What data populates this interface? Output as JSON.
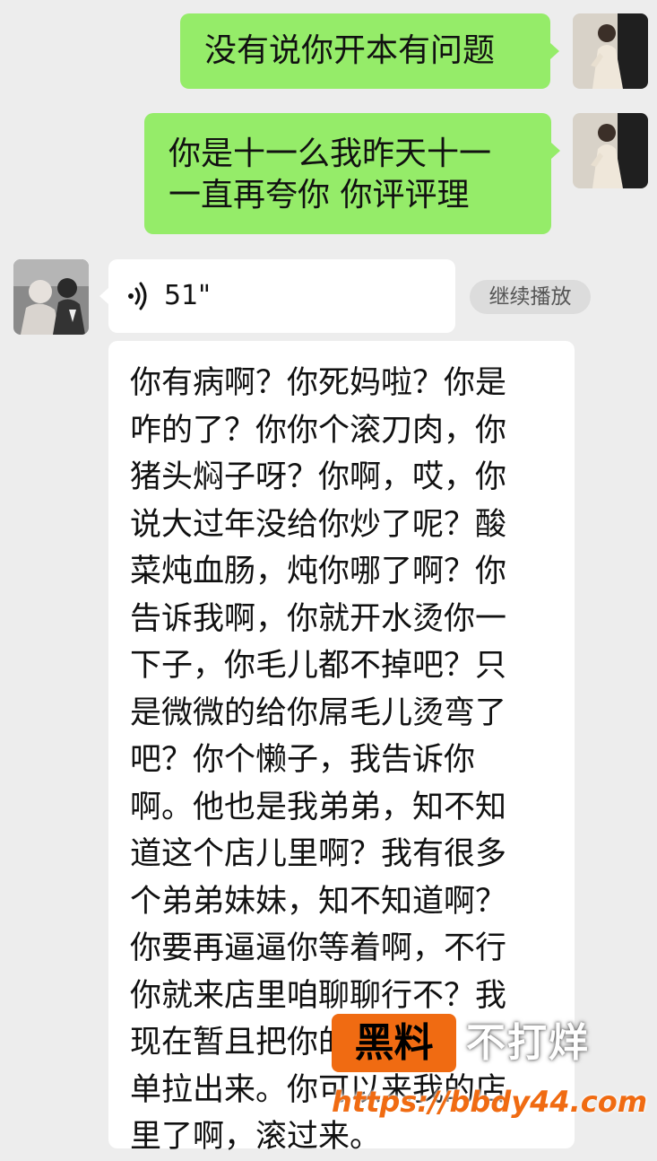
{
  "messages": [
    {
      "side": "right",
      "type": "text",
      "text": "没有说你开本有问题"
    },
    {
      "side": "right",
      "type": "text",
      "text": "你是十一么我昨天十一\n一直再夸你 你评评理"
    },
    {
      "side": "left",
      "type": "voice",
      "duration": "51\"",
      "action_label": "继续播放"
    },
    {
      "side": "left",
      "type": "transcript",
      "text": "你有病啊？你死妈啦？你是\n咋的了？你你个滚刀肉，你\n猪头焖子呀？你啊，哎，你\n说大过年没给你炒了呢？酸\n菜炖血肠，炖你哪了啊？你\n告诉我啊，你就开水烫你一\n下子，你毛儿都不掉吧？只\n是微微的给你屌毛儿烫弯了\n吧？你个懒子，我告诉你\n啊。他也是我弟弟，知不知\n道这个店儿里啊？我有很多\n个弟弟妹妹，知不知道啊？\n你要再逼逼你等着啊，不行\n你就来店里咱聊聊行不？我\n现在暂且把你的黑名\n单拉出来。你可以来我的店\n里了啊，滚过来。"
    }
  ],
  "watermark": {
    "logo_text": "黑料",
    "tagline": "不打烊",
    "url": "https://bbdy44.com",
    "colors": {
      "orange": "#f06b12"
    }
  },
  "colors": {
    "background": "#ededed",
    "outgoing_bubble": "#95ec69",
    "incoming_bubble": "#ffffff",
    "continue_button": "#dcdcdc"
  },
  "icons": {
    "voice": "voice-wave-icon",
    "sender_avatar": "avatar",
    "contact_avatar": "avatar"
  }
}
